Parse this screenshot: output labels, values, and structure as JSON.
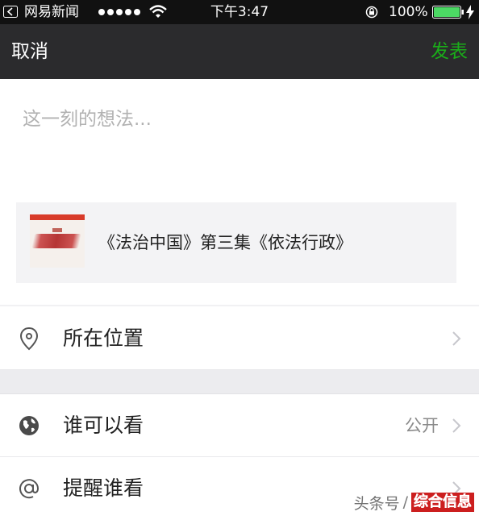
{
  "status_bar": {
    "app_name": "网易新闻",
    "time": "下午3:47",
    "battery_percent": "100%",
    "battery_level": 1.0,
    "signal_bars": 5
  },
  "nav": {
    "cancel_label": "取消",
    "post_label": "发表",
    "post_color": "#1aad19"
  },
  "compose": {
    "placeholder": "这一刻的想法..."
  },
  "link_card": {
    "title": "《法治中国》第三集《依法行政》"
  },
  "options": {
    "location_label": "所在位置",
    "visibility_label": "谁可以看",
    "visibility_value": "公开",
    "remind_label": "提醒谁看"
  },
  "watermark": {
    "source": "头条号",
    "account": "综合信息"
  },
  "icons": {
    "back": "back-arrow-icon",
    "wifi": "wifi-icon",
    "lock": "rotation-lock-icon",
    "battery": "battery-icon",
    "charge": "charging-icon",
    "location": "location-pin-icon",
    "globe": "globe-icon",
    "mention": "at-sign-icon",
    "chevron": "chevron-right-icon"
  }
}
